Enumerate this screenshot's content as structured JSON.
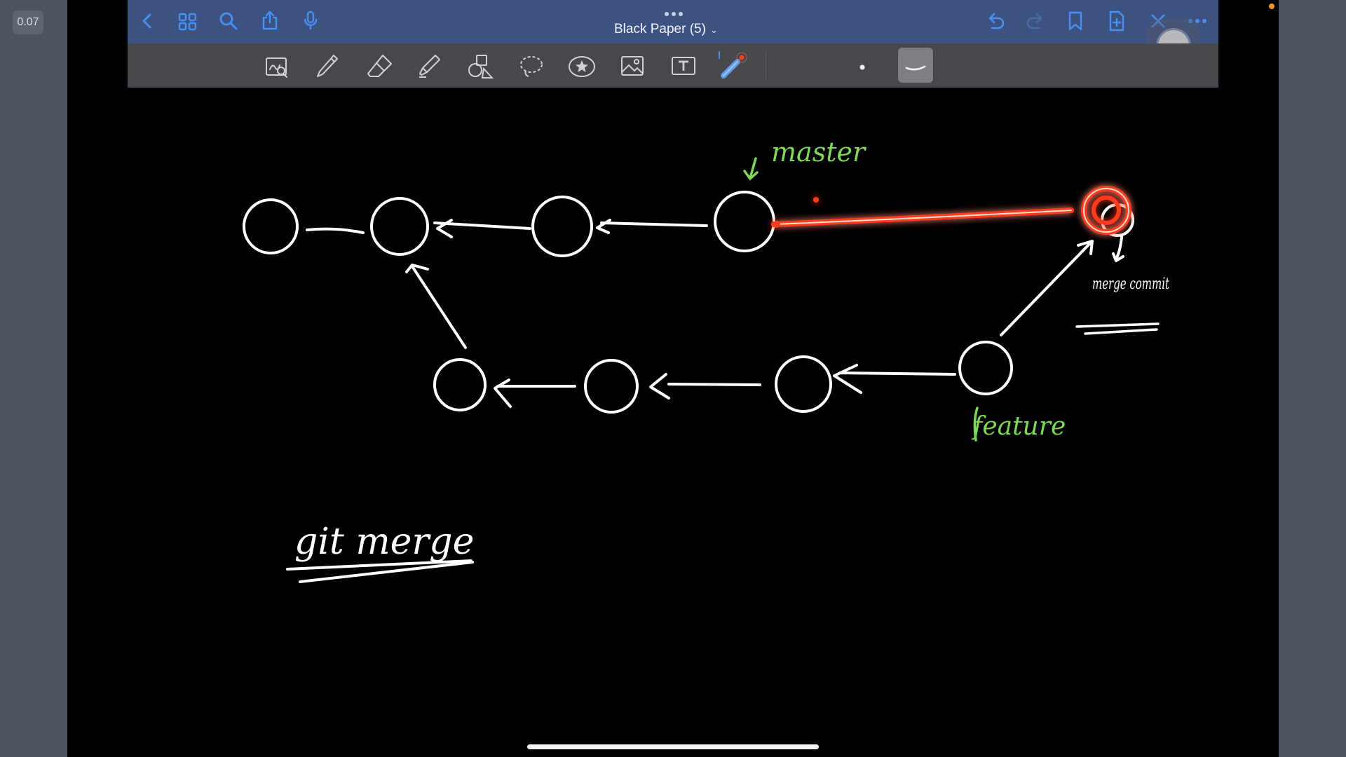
{
  "overlay": {
    "timer": "0.07"
  },
  "nav": {
    "document_title": "Black Paper  (5)",
    "title_chevron": "⌄"
  },
  "icons": {
    "left_group": [
      "back-icon",
      "grid-icon",
      "search-icon",
      "share-icon",
      "microphone-icon"
    ],
    "right_group": [
      "undo-icon",
      "redo-icon",
      "bookmark-icon",
      "add-page-icon",
      "close-icon",
      "more-icon"
    ],
    "tools": [
      "zoom-window-icon",
      "pen-icon",
      "eraser-icon",
      "highlighter-icon",
      "shapes-icon",
      "lasso-icon",
      "sticker-icon",
      "image-icon",
      "text-icon",
      "laser-pointer-icon"
    ]
  },
  "canvas": {
    "label_master": "master",
    "label_feature": "feature",
    "label_merge_commit": "merge commit",
    "label_git_merge": "git merge"
  },
  "colors": {
    "nav_bar": "#3c5382",
    "tool_bar": "#46484e",
    "accent_icon": "#4a90f2",
    "ink_white": "#ffffff",
    "ink_green": "#7ed957",
    "laser_red": "#ff3b1f"
  }
}
